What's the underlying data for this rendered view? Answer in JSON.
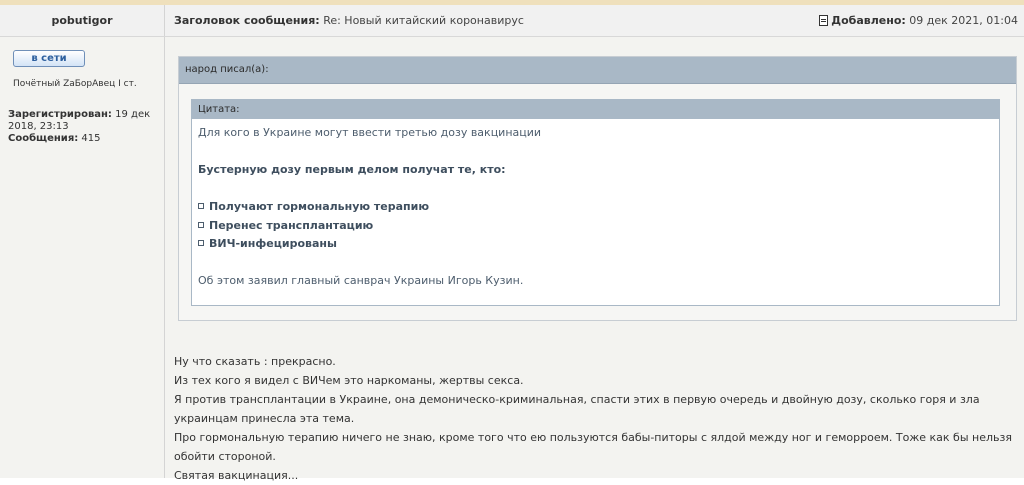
{
  "post": {
    "author": "pobutigor",
    "subject_label": "Заголовок сообщения:",
    "subject": "Re: Новый китайский коронавирус",
    "added_label": "Добавлено:",
    "added_date": "09 дек 2021, 01:04",
    "added_icon": "document-icon"
  },
  "user": {
    "online_label": "в сети",
    "rank": "Почётный ZaБорАвец I ст.",
    "registered_label": "Зарегистрирован:",
    "registered_value": "19 дек 2018, 23:13",
    "messages_label": "Сообщения:",
    "messages_value": "415"
  },
  "quote_outer": {
    "header": "народ писал(а):"
  },
  "quote_inner": {
    "header": "Цитата:",
    "line1": "Для кого в Украине могут ввести третью дозу вакцинации",
    "line2": "Бустерную дозу первым делом получат те, кто:",
    "bullets": [
      "Получают гормональную терапию",
      "Перенес трансплантацию",
      "ВИЧ-инфецированы"
    ],
    "line3": "Об этом заявил главный санврач Украины Игорь Кузин."
  },
  "reply": {
    "lines": [
      "Ну что сказать : прекрасно.",
      "Из тех кого я видел с ВИЧем это наркоманы, жертвы секса.",
      "Я против трансплантации в Украине, она демоническо-криминальная, спасти этих в первую очередь и двойную дозу, сколько горя и зла украинцам принесла эта тема.",
      "Про гормональную терапию ничего не знаю, кроме того что ею пользуются бабы-питоры с ялдой между ног и геморроем. Тоже как бы нельзя обойти стороной.",
      "Святая вакцинация..."
    ]
  }
}
